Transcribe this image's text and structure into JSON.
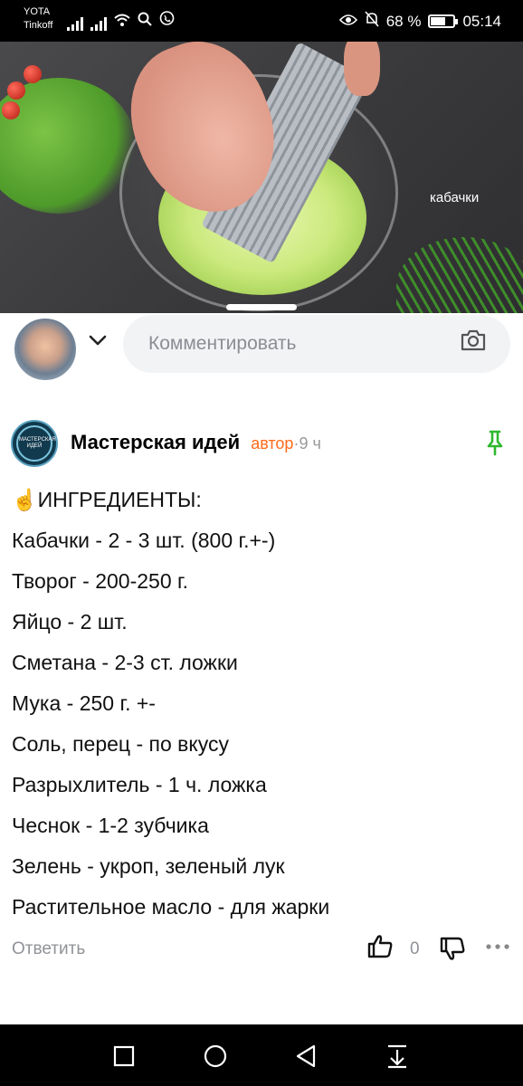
{
  "status_bar": {
    "carrier_1": "YOTA",
    "carrier_2": "Tinkoff",
    "battery_text": "68 %",
    "battery_level": 0.68,
    "time": "05:14"
  },
  "video": {
    "overlay_label": "кабачки"
  },
  "comment_input": {
    "placeholder": "Комментировать"
  },
  "comment": {
    "author": "Мастерская идей",
    "author_avatar_text": "МАСТЕРСКАЯ ИДЕЙ",
    "badge": "автор",
    "separator": "·",
    "time": "9 ч",
    "lines": [
      "☝️ИНГРЕДИЕНТЫ:",
      "Кабачки - 2 - 3 шт. (800 г.+-)",
      "Творог - 200-250 г.",
      "Яйцо - 2 шт.",
      "Сметана - 2-3 ст. ложки",
      "Мука - 250 г. +-",
      "Соль, перец - по вкусу",
      "Разрыхлитель - 1 ч. ложка",
      "Чеснок - 1-2 зубчика",
      "Зелень - укроп, зеленый лук",
      "Растительное масло - для жарки"
    ],
    "reply_label": "Ответить",
    "like_count": "0"
  },
  "icons": {
    "pin": "pin-icon",
    "like": "thumbs-up-icon",
    "dislike": "thumbs-down-icon",
    "more": "more-dots-icon",
    "camera": "camera-icon",
    "chevron": "chevron-down-icon"
  },
  "colors": {
    "badge": "#ff6a1a",
    "pin": "#2eb82e",
    "muted": "#8f9297",
    "input_bg": "#f2f3f5"
  }
}
